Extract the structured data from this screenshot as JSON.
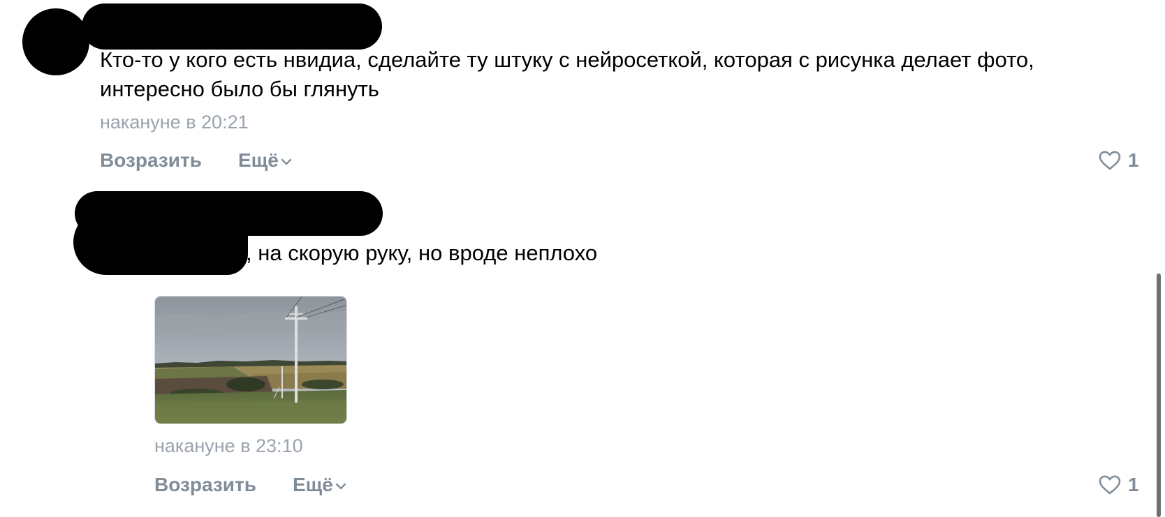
{
  "comments": [
    {
      "text_lines": [
        "Кто-то у кого есть нвидиа, сделайте ту штуку с нейросеткой, которая с рисунка делает фото,",
        "интересно было бы глянуть"
      ],
      "timestamp": "накануне в 20:21",
      "reply_label": "Возразить",
      "more_label": "Ещё",
      "like_count": "1"
    },
    {
      "text": ", на скорую руку, но вроде неплохо",
      "timestamp": "накануне в 23:10",
      "reply_label": "Возразить",
      "more_label": "Ещё",
      "like_count": "1"
    }
  ],
  "icons": {
    "like": "heart-icon",
    "more": "chevron-down-icon"
  },
  "colors": {
    "text": "#000000",
    "muted": "#818c99",
    "timestamp": "#99a2ad",
    "redaction": "#000000"
  }
}
